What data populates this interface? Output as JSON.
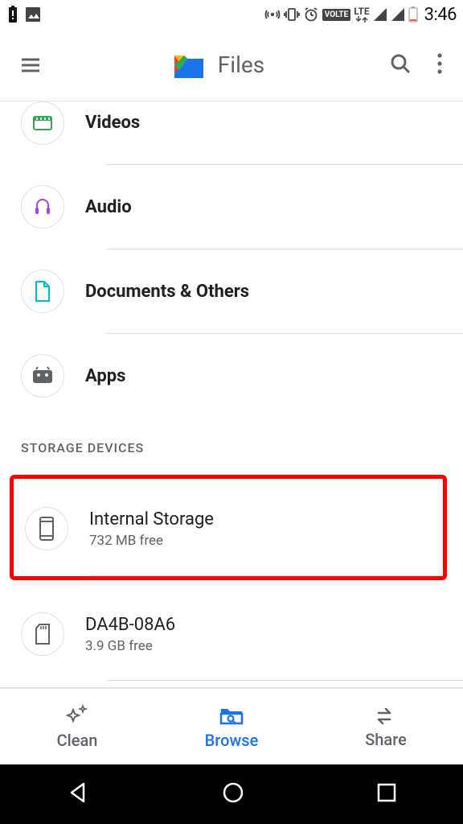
{
  "statusbar": {
    "volte": "VOLTE",
    "lte": "LTE",
    "time": "3:46"
  },
  "appbar": {
    "title": "Files"
  },
  "categories": [
    {
      "label": "Videos",
      "icon": "videos"
    },
    {
      "label": "Audio",
      "icon": "audio"
    },
    {
      "label": "Documents & Others",
      "icon": "documents"
    },
    {
      "label": "Apps",
      "icon": "apps"
    }
  ],
  "storage": {
    "section_title": "STORAGE DEVICES",
    "devices": [
      {
        "title": "Internal Storage",
        "sub": "732 MB free",
        "icon": "phone",
        "highlighted": true
      },
      {
        "title": "DA4B-08A6",
        "sub": "3.9 GB free",
        "icon": "sdcard",
        "highlighted": false
      }
    ]
  },
  "bottomnav": {
    "clean": "Clean",
    "browse": "Browse",
    "share": "Share",
    "active": "browse"
  }
}
